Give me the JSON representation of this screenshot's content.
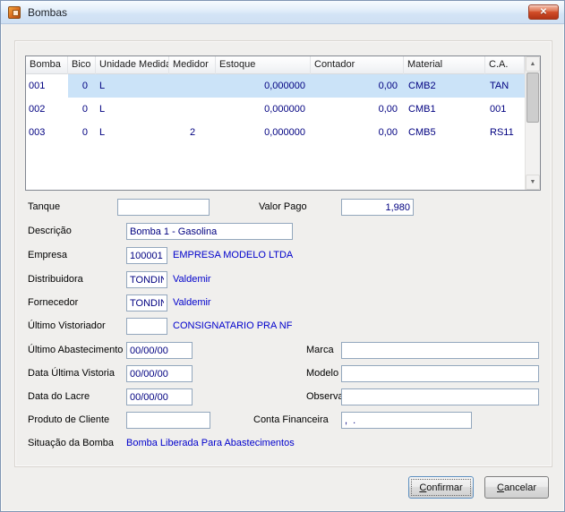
{
  "colors": {
    "selection": "#cbe3f8",
    "value_text": "#000080",
    "info_text": "#0000cc",
    "titlebar": "#d3e4f6"
  },
  "window": {
    "title": "Bombas"
  },
  "icons": {
    "close": "✕",
    "scroll_up": "▲",
    "scroll_down": "▼"
  },
  "table": {
    "columns": [
      "Bomba",
      "Bico",
      "Unidade Medida",
      "Medidor",
      "Estoque",
      "Contador",
      "Material",
      "C.A."
    ],
    "rows": [
      [
        "001",
        "0",
        "L",
        "",
        "0,000000",
        "0,00",
        "CMB2",
        "TAN"
      ],
      [
        "002",
        "0",
        "L",
        "",
        "0,000000",
        "0,00",
        "CMB1",
        "001"
      ],
      [
        "003",
        "0",
        "L",
        "2",
        "0,000000",
        "0,00",
        "CMB5",
        "RS11"
      ]
    ]
  },
  "fields": {
    "tanque": {
      "label": "Tanque",
      "value": ""
    },
    "valor_pago": {
      "label": "Valor Pago",
      "value": "1,980"
    },
    "descricao": {
      "label": "Descrição",
      "value": "Bomba 1 - Gasolina"
    },
    "empresa": {
      "label": "Empresa",
      "value": "100001",
      "info": "EMPRESA MODELO LTDA"
    },
    "distribuidora": {
      "label": "Distribuidora",
      "value": "TONDIN",
      "info": "Valdemir"
    },
    "fornecedor": {
      "label": "Fornecedor",
      "value": "TONDIN",
      "info": "Valdemir"
    },
    "ultimo_vistoriador": {
      "label": "Último Vistoriador",
      "value": "",
      "info": "CONSIGNATARIO PRA NF"
    },
    "ultimo_abastecimento": {
      "label": "Último Abastecimento",
      "value": "00/00/00"
    },
    "marca": {
      "label": "Marca",
      "value": ""
    },
    "data_ultima_vistoria": {
      "label": "Data Última Vistoria",
      "value": "00/00/00"
    },
    "modelo": {
      "label": "Modelo",
      "value": ""
    },
    "data_do_lacre": {
      "label": "Data do Lacre",
      "value": "00/00/00"
    },
    "observacao": {
      "label": "Observação",
      "value": ""
    },
    "produto_de_cliente": {
      "label": "Produto de Cliente",
      "value": ""
    },
    "conta_financeira": {
      "label": "Conta Financeira",
      "value": ",  ."
    },
    "situacao_da_bomba": {
      "label": "Situação da Bomba",
      "value": "Bomba Liberada Para Abastecimentos"
    }
  },
  "buttons": {
    "confirmar": {
      "accel": "C",
      "rest": "onfirmar"
    },
    "cancelar": {
      "accel": "C",
      "rest": "ancelar"
    }
  }
}
